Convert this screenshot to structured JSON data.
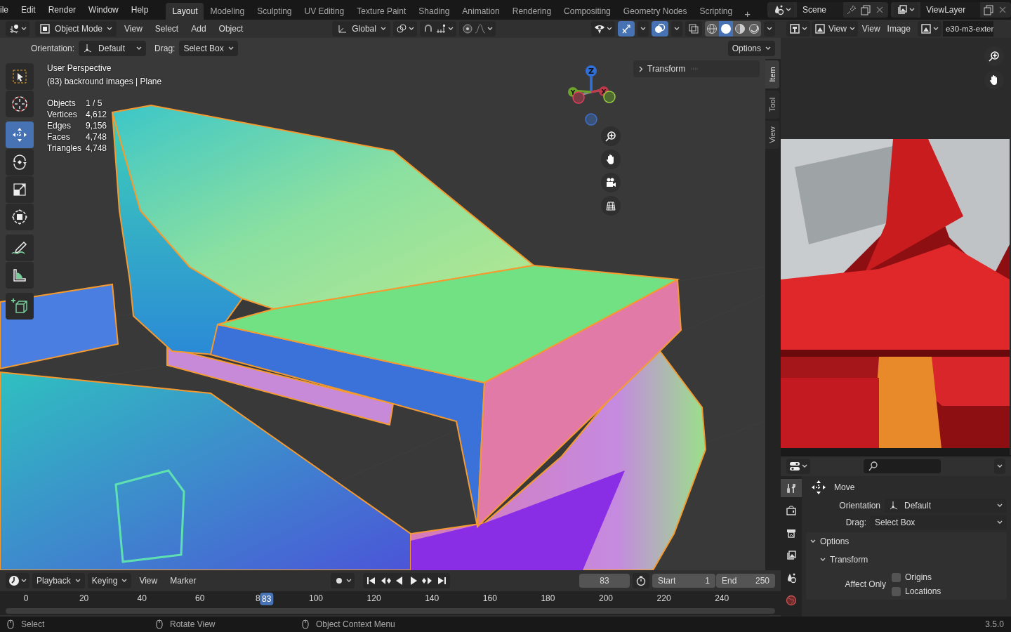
{
  "menu": [
    "ile",
    "Edit",
    "Render",
    "Window",
    "Help"
  ],
  "workspaces": [
    {
      "label": "Layout",
      "selected": true
    },
    {
      "label": "Modeling",
      "selected": false
    },
    {
      "label": "Sculpting",
      "selected": false
    },
    {
      "label": "UV Editing",
      "selected": false
    },
    {
      "label": "Texture Paint",
      "selected": false
    },
    {
      "label": "Shading",
      "selected": false
    },
    {
      "label": "Animation",
      "selected": false
    },
    {
      "label": "Rendering",
      "selected": false
    },
    {
      "label": "Compositing",
      "selected": false
    },
    {
      "label": "Geometry Nodes",
      "selected": false
    },
    {
      "label": "Scripting",
      "selected": false
    }
  ],
  "add_workspace": "+",
  "scene": "Scene",
  "view_layer": "ViewLayer",
  "viewport": {
    "mode": "Object Mode",
    "menus": [
      "View",
      "Select",
      "Add",
      "Object"
    ],
    "orientation": "Global",
    "gizmos_on": true,
    "overlays_on": true,
    "shading": [
      {
        "kind": "wireframe",
        "selected": false
      },
      {
        "kind": "solid",
        "selected": true
      },
      {
        "kind": "material",
        "selected": false
      },
      {
        "kind": "rendered",
        "selected": false
      }
    ],
    "tool_settings": {
      "orientation_label": "Orientation:",
      "orientation": "Default",
      "drag_label": "Drag:",
      "drag": "Select Box",
      "options": "Options"
    },
    "tool_groups": [
      [
        {
          "kind": "select_box",
          "selected": false
        },
        {
          "kind": "cursor",
          "selected": false
        }
      ],
      [
        {
          "kind": "move",
          "selected": true
        },
        {
          "kind": "rotate",
          "selected": false
        },
        {
          "kind": "scale",
          "selected": false
        },
        {
          "kind": "transform",
          "selected": false
        }
      ],
      [
        {
          "kind": "annotate",
          "selected": false
        },
        {
          "kind": "measure",
          "selected": false
        }
      ],
      [
        {
          "kind": "add_cube",
          "selected": false
        }
      ]
    ],
    "view_name": "User Perspective",
    "object_info": "(83) backround images | Plane",
    "stats": [
      {
        "label": "Objects",
        "value": "1 / 5"
      },
      {
        "label": "Vertices",
        "value": "4,612"
      },
      {
        "label": "Edges",
        "value": "9,156"
      },
      {
        "label": "Faces",
        "value": "4,748"
      },
      {
        "label": "Triangles",
        "value": "4,748"
      }
    ],
    "gizmo_axes": [
      "Z",
      "Y",
      "X"
    ],
    "sidebar": {
      "panels": [
        {
          "title": "Transform",
          "expanded": false
        }
      ],
      "tabs": [
        {
          "label": "Item",
          "selected": true
        },
        {
          "label": "Tool",
          "selected": false
        },
        {
          "label": "View",
          "selected": false
        }
      ]
    }
  },
  "image_editor": {
    "mode": "View",
    "menus": [
      "View",
      "Image"
    ],
    "image_name": "e30-m3-exter",
    "image": {
      "kind": "picture"
    }
  },
  "properties": {
    "tabs": [
      {
        "kind": "tool",
        "selected": true
      },
      {
        "kind": "render",
        "selected": false
      },
      {
        "kind": "output",
        "selected": false
      },
      {
        "kind": "view_layer",
        "selected": false
      },
      {
        "kind": "scene",
        "selected": false
      },
      {
        "kind": "world",
        "selected": false
      }
    ],
    "tool_name": "Move",
    "orientation_label": "Orientation",
    "orientation": "Default",
    "drag_label": "Drag:",
    "drag": "Select Box",
    "panels": [
      {
        "title": "Options",
        "expanded": true,
        "children": [
          {
            "title": "Transform",
            "expanded": true
          }
        ]
      }
    ],
    "affect_only_label": "Affect Only",
    "checkboxes": [
      {
        "label": "Origins",
        "checked": false
      },
      {
        "label": "Locations",
        "checked": false
      }
    ]
  },
  "timeline": {
    "dropdown_menus": [
      "Playback",
      "Keying"
    ],
    "menus": [
      "View",
      "Marker"
    ],
    "current_frame": "83",
    "start_label": "Start",
    "start": "1",
    "end_label": "End",
    "end": "250",
    "ruler": [
      "0",
      "20",
      "40",
      "60",
      "8",
      "100",
      "120",
      "140",
      "160",
      "180",
      "200",
      "220",
      "240"
    ],
    "playhead": "83"
  },
  "status": [
    {
      "label": "Select"
    },
    {
      "label": "Rotate View"
    },
    {
      "label": "Object Context Menu"
    }
  ],
  "version": "3.5.0"
}
